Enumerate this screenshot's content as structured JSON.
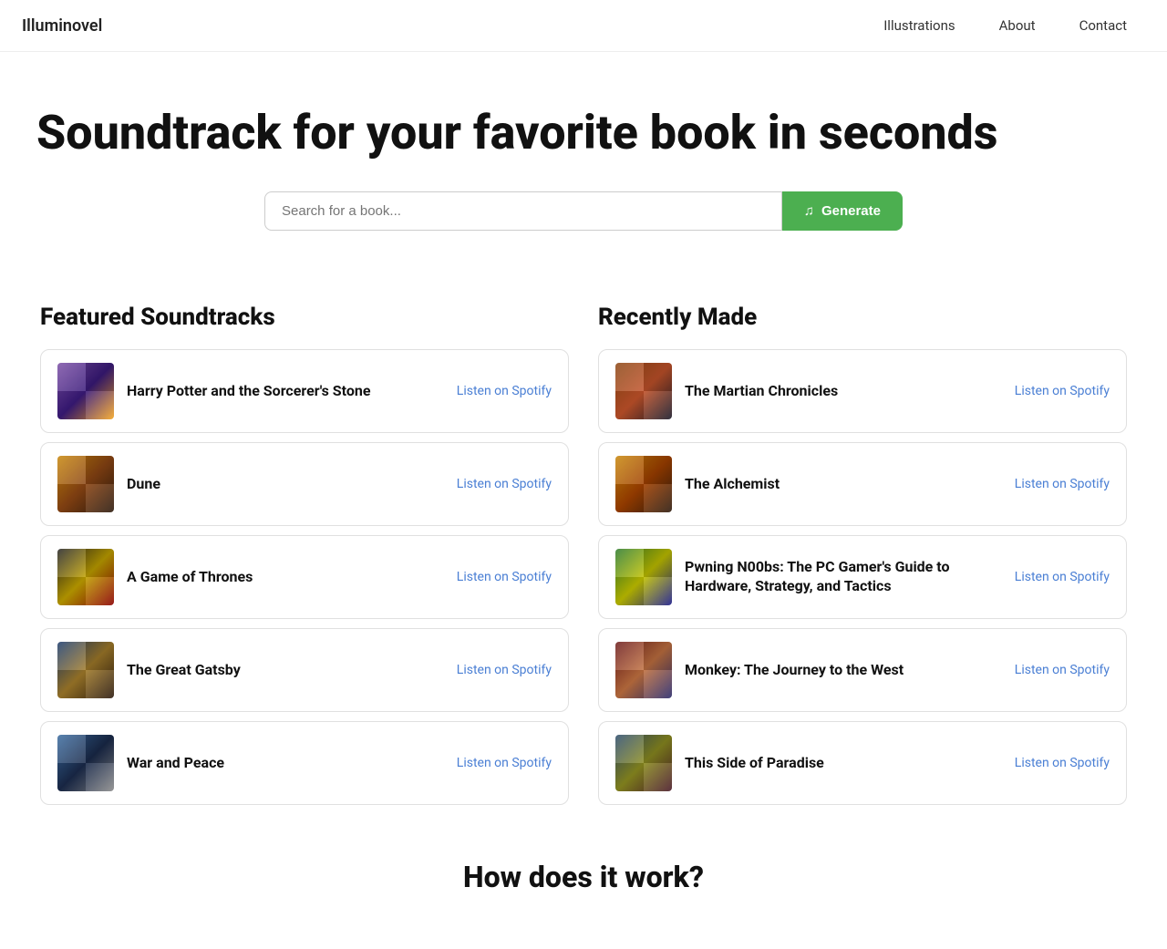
{
  "nav": {
    "logo": "Illuminovel",
    "links": [
      {
        "label": "Illustrations",
        "id": "illustrations"
      },
      {
        "label": "About",
        "id": "about"
      },
      {
        "label": "Contact",
        "id": "contact"
      }
    ]
  },
  "hero": {
    "headline": "Soundtrack for your favorite book in seconds",
    "search_placeholder": "Search for a book...",
    "generate_label": "Generate",
    "music_icon": "♫"
  },
  "featured": {
    "title": "Featured Soundtracks",
    "books": [
      {
        "id": "harry-potter",
        "title": "Harry Potter and the Sorcerer's Stone",
        "cover_class": "cover-hp",
        "listen_label": "Listen on Spotify"
      },
      {
        "id": "dune",
        "title": "Dune",
        "cover_class": "cover-dune",
        "listen_label": "Listen on Spotify"
      },
      {
        "id": "game-of-thrones",
        "title": "A Game of Thrones",
        "cover_class": "cover-got",
        "listen_label": "Listen on Spotify"
      },
      {
        "id": "great-gatsby",
        "title": "The Great Gatsby",
        "cover_class": "cover-gatsby",
        "listen_label": "Listen on Spotify"
      },
      {
        "id": "war-and-peace",
        "title": "War and Peace",
        "cover_class": "cover-wap",
        "listen_label": "Listen on Spotify"
      }
    ]
  },
  "recently_made": {
    "title": "Recently Made",
    "books": [
      {
        "id": "martian-chronicles",
        "title": "The Martian Chronicles",
        "cover_class": "cover-martian",
        "listen_label": "Listen on Spotify"
      },
      {
        "id": "alchemist",
        "title": "The Alchemist",
        "cover_class": "cover-alchemist",
        "listen_label": "Listen on Spotify"
      },
      {
        "id": "pwning-noobs",
        "title": "Pwning N00bs: The PC Gamer's Guide to Hardware, Strategy, and Tactics",
        "cover_class": "cover-pwning",
        "listen_label": "Listen on Spotify"
      },
      {
        "id": "monkey-journey",
        "title": "Monkey: The Journey to the West",
        "cover_class": "cover-monkey",
        "listen_label": "Listen on Spotify"
      },
      {
        "id": "this-side-paradise",
        "title": "This Side of Paradise",
        "cover_class": "cover-paradise",
        "listen_label": "Listen on Spotify"
      }
    ]
  },
  "how": {
    "title": "How does it work?"
  }
}
